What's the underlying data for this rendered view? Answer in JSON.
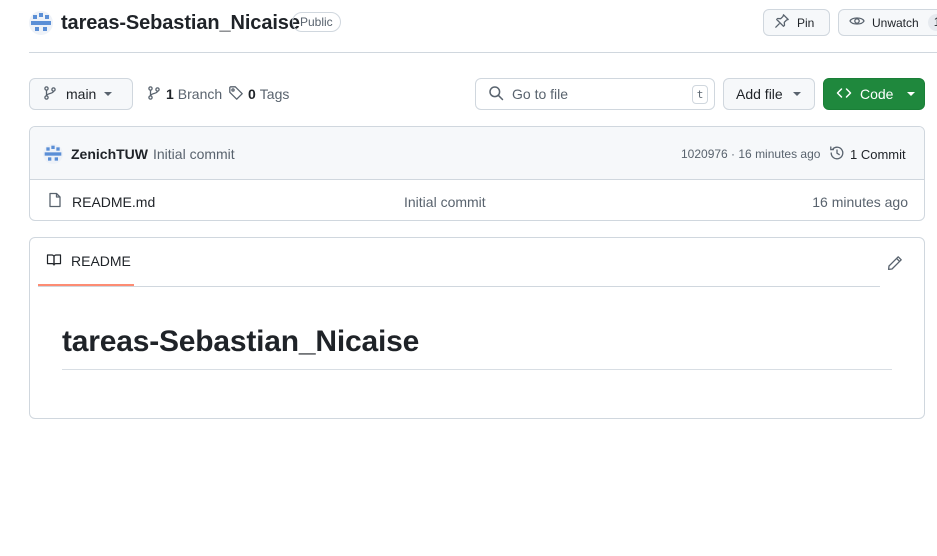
{
  "header": {
    "repo_name": "tareas-Sebastian_Nicaise",
    "visibility": "Public",
    "pin_label": "Pin",
    "watch_label": "Unwatch",
    "watch_count": "1"
  },
  "toolbar": {
    "branch": "main",
    "branch_count": "1",
    "branch_label": "Branch",
    "tag_count": "0",
    "tag_label": "Tags",
    "search_placeholder": "Go to file",
    "search_shortcut": "t",
    "add_file_label": "Add file",
    "code_label": "Code"
  },
  "latest_commit": {
    "author": "ZenichTUW",
    "message": "Initial commit",
    "meta": "1020976 · 16 minutes ago",
    "commit_count": "1 Commit"
  },
  "files": [
    {
      "name": "README.md",
      "message": "Initial commit",
      "time": "16 minutes ago",
      "icon": "file-icon"
    }
  ],
  "readme": {
    "tab_label": "README",
    "heading": "tareas-Sebastian_Nicaise"
  },
  "colors": {
    "accent_green": "#1f883d",
    "tab_underline": "#fd8c73",
    "border": "#d0d7de",
    "muted_text": "#59636e"
  }
}
